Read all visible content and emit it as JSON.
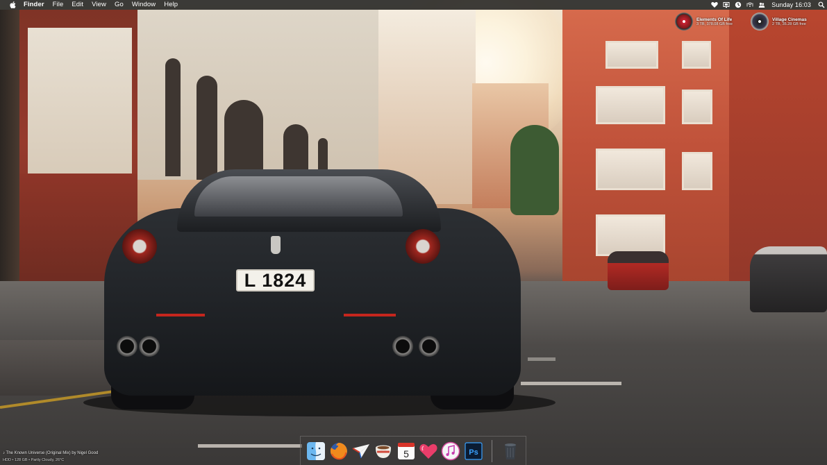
{
  "menubar": {
    "apple_icon": "apple-icon",
    "app_name": "Finder",
    "menus": [
      "File",
      "Edit",
      "View",
      "Go",
      "Window",
      "Help"
    ],
    "status_icons": [
      "heart-icon",
      "display-icon",
      "timer-icon",
      "wifi-icon",
      "users-icon"
    ],
    "clock": "Sunday 16:03",
    "search_icon": "search-icon"
  },
  "desktop": {
    "drives": [
      {
        "name": "Elements Of Life",
        "info": "3 TB, 378.08 GB free"
      },
      {
        "name": "Village Cinemas",
        "info": "2 TB, 35.28 GB free"
      }
    ],
    "license_plate": "L  1824",
    "now_playing": "♪ The Known Universe (Original Mix) by Nigel Good",
    "status_line": "HDD • 128 GB • Partly Cloudy, 26°C"
  },
  "dock": {
    "apps": [
      {
        "name": "Finder",
        "icon": "finder-icon"
      },
      {
        "name": "Firefox",
        "icon": "firefox-icon"
      },
      {
        "name": "Sparrow",
        "icon": "paper-plane-icon"
      },
      {
        "name": "Caffeine",
        "icon": "coffee-cup-icon"
      },
      {
        "name": "Calendar",
        "icon": "calendar-icon",
        "day": "5"
      },
      {
        "name": "Heart",
        "icon": "heart-app-icon"
      },
      {
        "name": "iTunes",
        "icon": "itunes-icon"
      },
      {
        "name": "Photoshop",
        "icon": "photoshop-icon",
        "label": "Ps"
      }
    ],
    "trash": {
      "name": "Trash",
      "icon": "trash-icon"
    }
  },
  "colors": {
    "menubar_bg": "#141414",
    "ferrari_body": "#23262a",
    "brick": "#c0523a"
  }
}
